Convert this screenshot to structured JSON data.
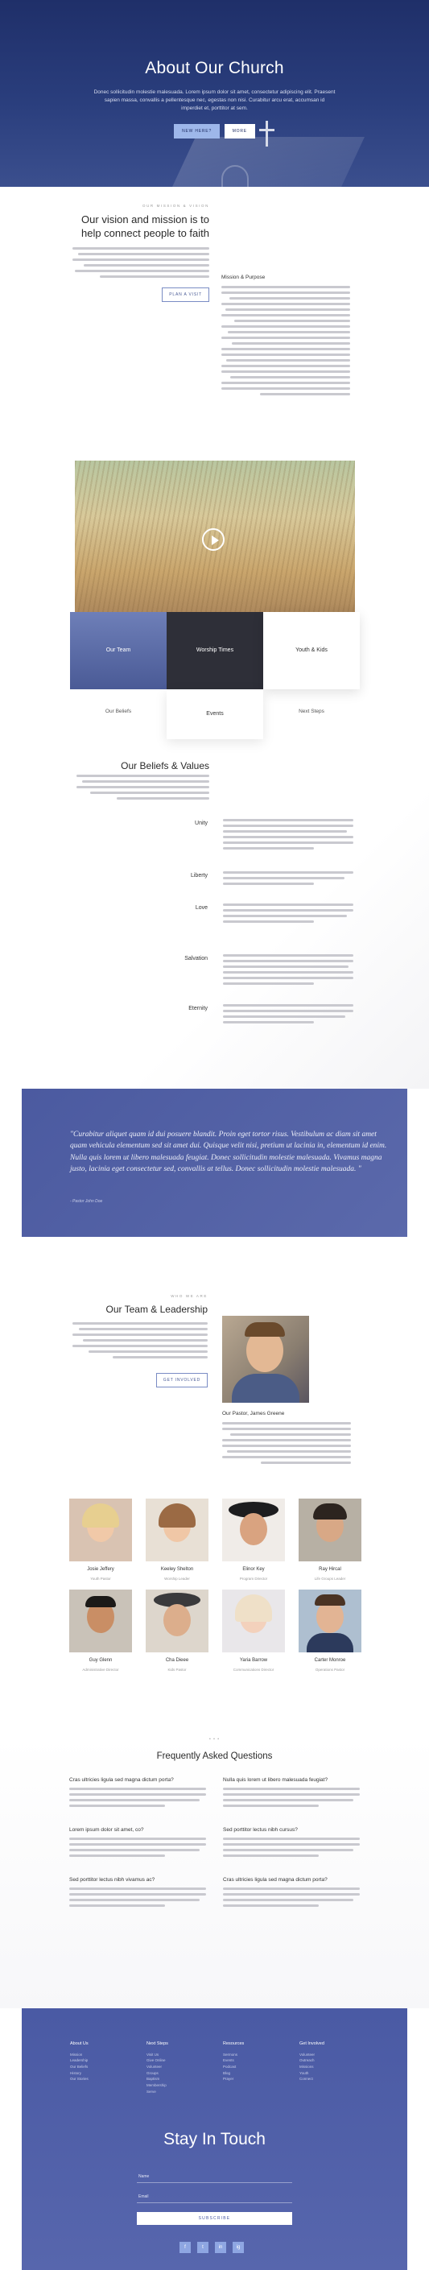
{
  "hero": {
    "title": "About Our Church",
    "subtitle": "Donec sollicitudin molestie malesuada. Lorem ipsum dolor sit amet, consectetur adipiscing elit. Praesent sapien massa, convallis a pellentesque nec, egestas non nisi. Curabitur arcu erat, accumsan id imperdiet et, porttitor at sem.",
    "primary_button": "New Here?",
    "secondary_button": "More"
  },
  "mission": {
    "eyebrow": "Our mission & vision",
    "title": "Our vision and mission is to help connect people to faith",
    "button": "Plan a Visit",
    "sidebar_title": "Mission & Purpose"
  },
  "media": {
    "tiles": [
      "Our Team",
      "Worship Times",
      "Youth & Kids"
    ],
    "links": [
      "Our Beliefs",
      "Events",
      "Next Steps"
    ]
  },
  "beliefs": {
    "title": "Our Beliefs & Values",
    "items": [
      "Unity",
      "Liberty",
      "Love",
      "Salvation",
      "Eternity"
    ]
  },
  "quote": {
    "text": "\"Curabitur aliquet quam id dui posuere blandit. Proin eget tortor risus. Vestibulum ac diam sit amet quam vehicula elementum sed sit amet dui. Quisque velit nisi, pretium ut lacinia in, elementum id enim. Nulla quis lorem ut libero malesuada feugiat. Donec sollicitudin molestie malesuada. Vivamus magna justo, lacinia eget consectetur sed, convallis at tellus. Donec sollicitudin molestie malesuada. \"",
    "author": "- Pastor John Doe"
  },
  "team": {
    "eyebrow": "Who we are",
    "title": "Our Team & Leadership",
    "button": "Get Involved",
    "pastor_name": "Our Pastor, James Greene",
    "members": [
      {
        "name": "Josie Jeffery",
        "role": "Youth Pastor"
      },
      {
        "name": "Keeley Shelton",
        "role": "Worship Leader"
      },
      {
        "name": "Elinor Key",
        "role": "Program Director"
      },
      {
        "name": "Ray Hircal",
        "role": "Life Groups Leader"
      },
      {
        "name": "Guy Glenn",
        "role": "Administrative Director"
      },
      {
        "name": "Cha Dieee",
        "role": "Kids Pastor"
      },
      {
        "name": "Yaria Barrow",
        "role": "Communications Director"
      },
      {
        "name": "Carter Monroe",
        "role": "Operations Pastor"
      }
    ]
  },
  "faq": {
    "dots": "• • •",
    "title": "Frequently Asked Questions",
    "questions": [
      "Cras ultricies ligula sed magna dictum porta?",
      "Nulla quis lorem ut libero malesuada feugiat?",
      "Lorem ipsum dolor sit amet, co?",
      "Sed porttitor lectus nibh cursus?",
      "Sed porttitor lectus nibh vivamus ac?",
      "Cras ultricies ligula sed magna dictum porta?"
    ]
  },
  "footer": {
    "columns": [
      {
        "title": "About Us",
        "links": [
          "Mission",
          "Leadership",
          "Our Beliefs",
          "History",
          "Our Stories"
        ]
      },
      {
        "title": "Next Steps",
        "links": [
          "Visit Us",
          "Give Online",
          "Volunteer",
          "Groups",
          "Baptism",
          "Membership",
          "Serve"
        ]
      },
      {
        "title": "Resources",
        "links": [
          "Sermons",
          "Events",
          "Podcast",
          "Blog",
          "Prayer"
        ]
      },
      {
        "title": "Get Involved",
        "links": [
          "Volunteer",
          "Outreach",
          "Missions",
          "Youth",
          "Connect"
        ]
      }
    ],
    "title": "Stay In Touch",
    "name_label": "Name",
    "email_label": "Email",
    "subscribe": "Subscribe",
    "social": [
      "f",
      "t",
      "in",
      "ig"
    ]
  },
  "colors": {
    "hero_bg": "#1f2f69",
    "accent": "#4b5aa0",
    "button_light": "#9eb7ea"
  }
}
